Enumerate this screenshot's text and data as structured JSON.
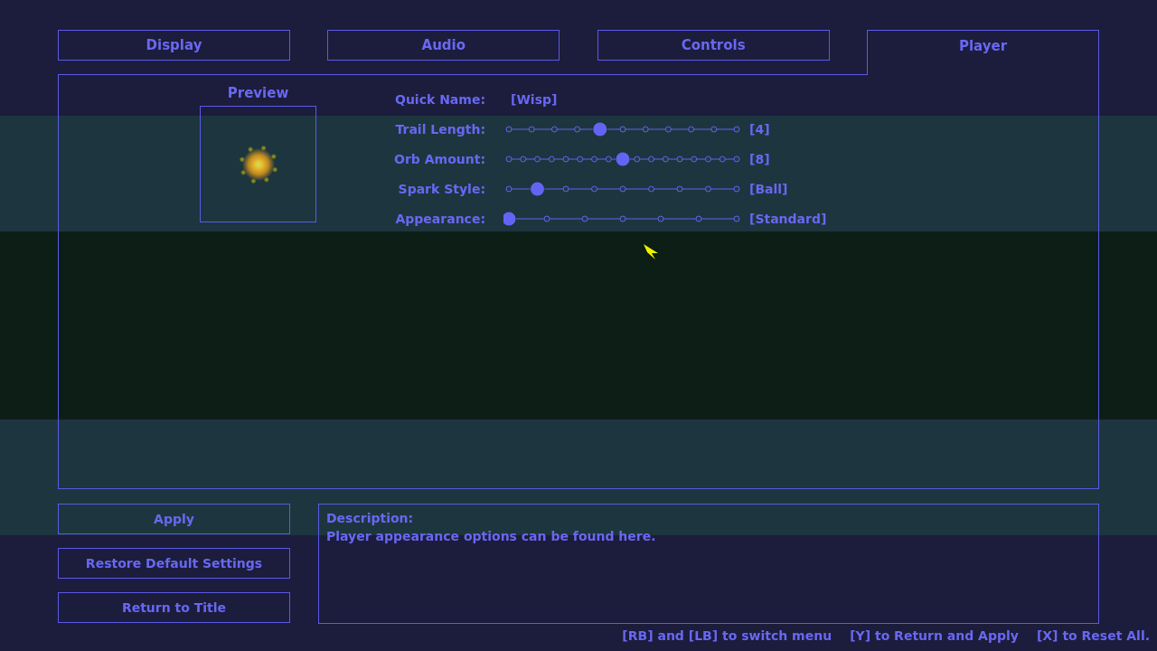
{
  "tabs": [
    {
      "label": "Display",
      "selected": false
    },
    {
      "label": "Audio",
      "selected": false
    },
    {
      "label": "Controls",
      "selected": false
    },
    {
      "label": "Player",
      "selected": true
    }
  ],
  "preview": {
    "label": "Preview"
  },
  "settings": [
    {
      "kind": "text",
      "label": "Quick Name:",
      "value": "[Wisp]"
    },
    {
      "kind": "slider",
      "label": "Trail Length:",
      "level": 0.4,
      "value": "[4]",
      "stops": [
        {
          "selected": false
        },
        {
          "selected": false
        },
        {
          "selected": false
        },
        {
          "selected": false
        },
        {
          "selected": true
        },
        {
          "selected": false
        },
        {
          "selected": false
        },
        {
          "selected": false
        },
        {
          "selected": false
        },
        {
          "selected": false
        },
        {
          "selected": false
        }
      ]
    },
    {
      "kind": "slider",
      "label": "Orb Amount:",
      "level": 0.5,
      "value": "[8]",
      "stops": [
        {
          "selected": false
        },
        {
          "selected": false
        },
        {
          "selected": false
        },
        {
          "selected": false
        },
        {
          "selected": false
        },
        {
          "selected": false
        },
        {
          "selected": false
        },
        {
          "selected": false
        },
        {
          "selected": true
        },
        {
          "selected": false
        },
        {
          "selected": false
        },
        {
          "selected": false
        },
        {
          "selected": false
        },
        {
          "selected": false
        },
        {
          "selected": false
        },
        {
          "selected": false
        },
        {
          "selected": false
        }
      ]
    },
    {
      "kind": "slider",
      "label": "Spark Style:",
      "level": 0.125,
      "value": "[Ball]",
      "stops": [
        {
          "selected": false
        },
        {
          "selected": true
        },
        {
          "selected": false
        },
        {
          "selected": false
        },
        {
          "selected": false
        },
        {
          "selected": false
        },
        {
          "selected": false
        },
        {
          "selected": false
        },
        {
          "selected": false
        }
      ]
    },
    {
      "kind": "slider",
      "label": "Appearance:",
      "level": 0,
      "value": "[Standard]",
      "stops": [
        {
          "selected": true
        },
        {
          "selected": false
        },
        {
          "selected": false
        },
        {
          "selected": false
        },
        {
          "selected": false
        },
        {
          "selected": false
        },
        {
          "selected": false
        }
      ]
    }
  ],
  "buttons": [
    "Apply",
    "Restore Default Settings",
    "Return to Title"
  ],
  "description": {
    "title": "Description:",
    "text": "Player appearance options can be found here."
  },
  "hints": [
    "[RB] and [LB] to switch menu",
    "[Y] to Return and Apply",
    "[X] to Reset All."
  ]
}
